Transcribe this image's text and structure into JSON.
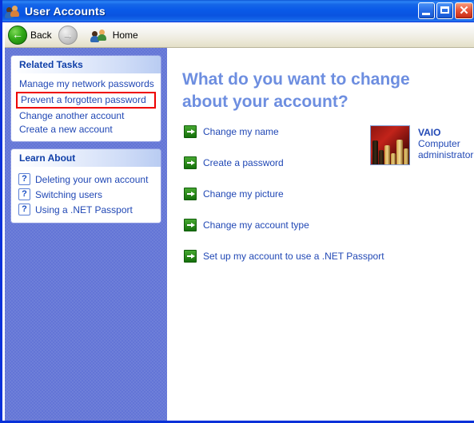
{
  "window": {
    "title": "User Accounts",
    "title_icon": "user-accounts-icon",
    "minimize_label": "_",
    "maximize_label": "",
    "close_label": "✕"
  },
  "toolbar": {
    "back_label": "Back",
    "back_icon": "back-arrow-icon",
    "forward_label": "",
    "forward_icon": "forward-arrow-icon",
    "home_label": "Home",
    "home_icon": "users-icon"
  },
  "sidebar": {
    "related_tasks": {
      "header": "Related Tasks",
      "items": [
        {
          "label": "Manage my network passwords",
          "highlighted": false
        },
        {
          "label": "Prevent a forgotten password",
          "highlighted": true
        },
        {
          "label": "Change another account",
          "highlighted": false
        },
        {
          "label": "Create a new account",
          "highlighted": false
        }
      ]
    },
    "learn_about": {
      "header": "Learn About",
      "icon": "question-mark-icon",
      "items": [
        {
          "label": "Deleting your own account"
        },
        {
          "label": "Switching users"
        },
        {
          "label": "Using a .NET Passport"
        }
      ]
    }
  },
  "main": {
    "heading": "What do you want to change about your account?",
    "task_icon": "green-arrow-icon",
    "tasks": [
      {
        "label": "Change my name"
      },
      {
        "label": "Create a password"
      },
      {
        "label": "Change my picture"
      },
      {
        "label": "Change my account type"
      },
      {
        "label": "Set up my account to use a .NET Passport"
      }
    ],
    "account": {
      "name": "VAIO",
      "type": "Computer administrator",
      "avatar_icon": "chess-pieces-avatar"
    }
  },
  "colors": {
    "titlebar_blue": "#0a5ae8",
    "sidebar_blue": "#6375d6",
    "link_blue": "#2148b5",
    "heading_blue": "#6d8ee0",
    "highlight_red": "#ee0000",
    "green_arrow": "#2e8c1c"
  }
}
